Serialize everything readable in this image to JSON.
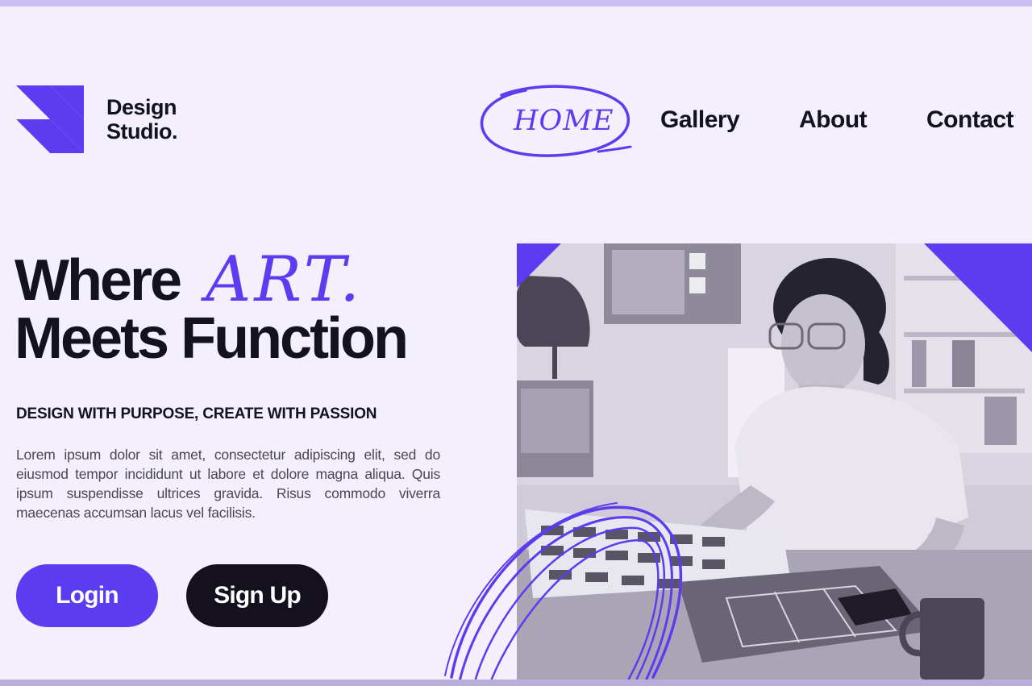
{
  "brand": {
    "name_line1": "Design",
    "name_line2": "Studio.",
    "logo_icon": "geometric-triangles-logo",
    "accent_color": "#5b3cf0"
  },
  "nav": {
    "items": [
      {
        "label": "HOME",
        "active": true
      },
      {
        "label": "Gallery"
      },
      {
        "label": "About"
      },
      {
        "label": "Contact"
      }
    ]
  },
  "hero": {
    "title_line1": "Where",
    "title_art": "ART.",
    "title_line2": "Meets Function",
    "tagline": "DESIGN WITH PURPOSE, CREATE WITH PASSION",
    "body": "Lorem ipsum dolor sit amet, consectetur adipiscing elit, sed do eiusmod tempor incididunt ut labore et dolore magna aliqua. Quis ipsum suspendisse ultrices gravida. Risus commodo viverra maecenas accumsan lacus vel facilisis."
  },
  "buttons": {
    "login": "Login",
    "signup": "Sign Up",
    "login_color": "#5b3cf0",
    "signup_color": "#15101e"
  },
  "photo": {
    "subject": "woman-designer-at-desk-photo"
  }
}
